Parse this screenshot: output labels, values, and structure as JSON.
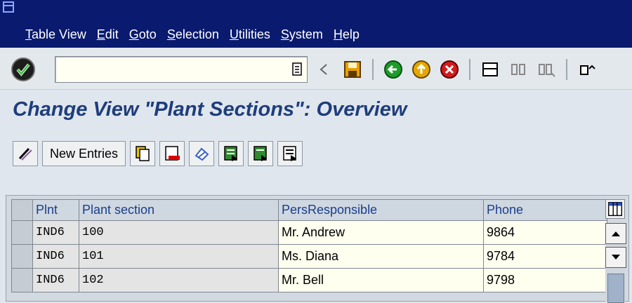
{
  "menu": [
    "Table View",
    "Edit",
    "Goto",
    "Selection",
    "Utilities",
    "System",
    "Help"
  ],
  "command_field": {
    "value": ""
  },
  "page_title": "Change View \"Plant Sections\": Overview",
  "app_toolbar": {
    "new_entries_label": "New Entries"
  },
  "table": {
    "headers": {
      "plnt": "Plnt",
      "section": "Plant section",
      "pers": "PersResponsible",
      "phone": "Phone"
    },
    "rows": [
      {
        "plnt": "IND6",
        "section": "100",
        "pers": "Mr. Andrew",
        "phone": "9864"
      },
      {
        "plnt": "IND6",
        "section": "101",
        "pers": "Ms. Diana",
        "phone": "9784"
      },
      {
        "plnt": "IND6",
        "section": "102",
        "pers": "Mr. Bell",
        "phone": "9798"
      }
    ]
  },
  "icons": [
    "system-menu-icon",
    "enter-check-icon",
    "command-history-icon",
    "back-arrow-icon",
    "save-icon",
    "back-icon",
    "exit-icon",
    "cancel-icon",
    "print-icon",
    "find-icon",
    "find-next-icon",
    "first-page-icon",
    "display-change-icon",
    "copy-as-icon",
    "delete-icon",
    "undo-change-icon",
    "select-all-icon",
    "select-block-icon",
    "deselect-all-icon",
    "column-settings-icon",
    "scroll-up-icon",
    "scroll-down-icon"
  ],
  "colors": {
    "title_bar": "#0a1a6e",
    "title_text": "#1f3d7b",
    "header_text": "#1a3f8a",
    "cell_bg": "#fffff0"
  }
}
